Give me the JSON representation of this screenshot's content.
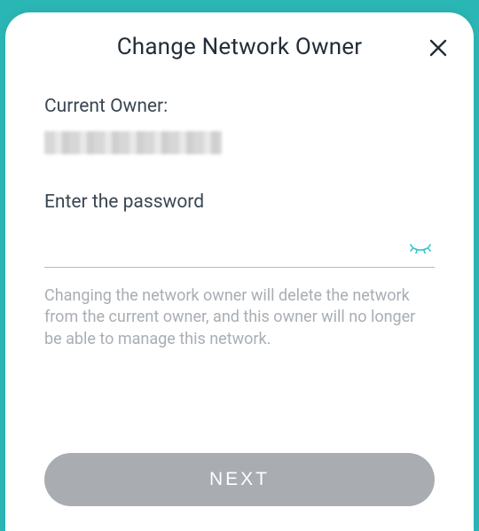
{
  "dialog": {
    "title": "Change Network Owner",
    "current_owner_label": "Current Owner:",
    "current_owner_value": "",
    "password_label": "Enter the password",
    "password_value": "",
    "password_placeholder": "",
    "note": "Changing the network owner will delete the network from the current owner, and this owner will no longer be able to manage this network.",
    "next_label": "NEXT"
  },
  "colors": {
    "accent": "#2bb6b6",
    "eye_icon": "#37c3cf",
    "button_bg": "#a9adb1"
  }
}
